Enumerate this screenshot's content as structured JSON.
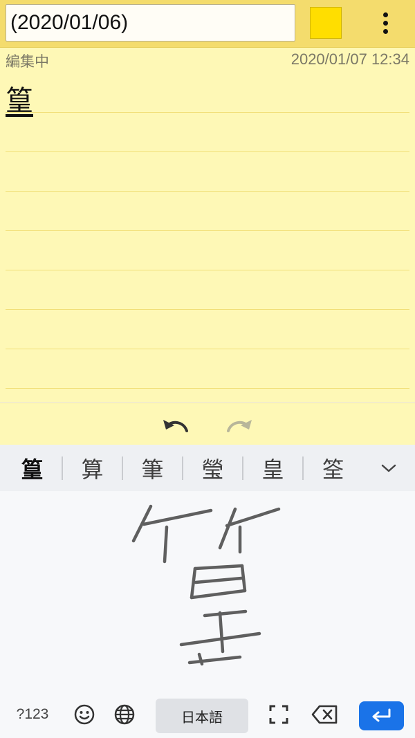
{
  "header": {
    "title_value": "(2020/01/06)",
    "color": "#FFDE00"
  },
  "note": {
    "status": "編集中",
    "timestamp": "2020/01/07 12:34",
    "text": "篁"
  },
  "suggestions": [
    "篁",
    "算",
    "筆",
    "瑩",
    "皇",
    "筌"
  ],
  "keyboard": {
    "symbols_label": "?123",
    "space_label": "日本語",
    "enter_color": "#1A73E8"
  }
}
